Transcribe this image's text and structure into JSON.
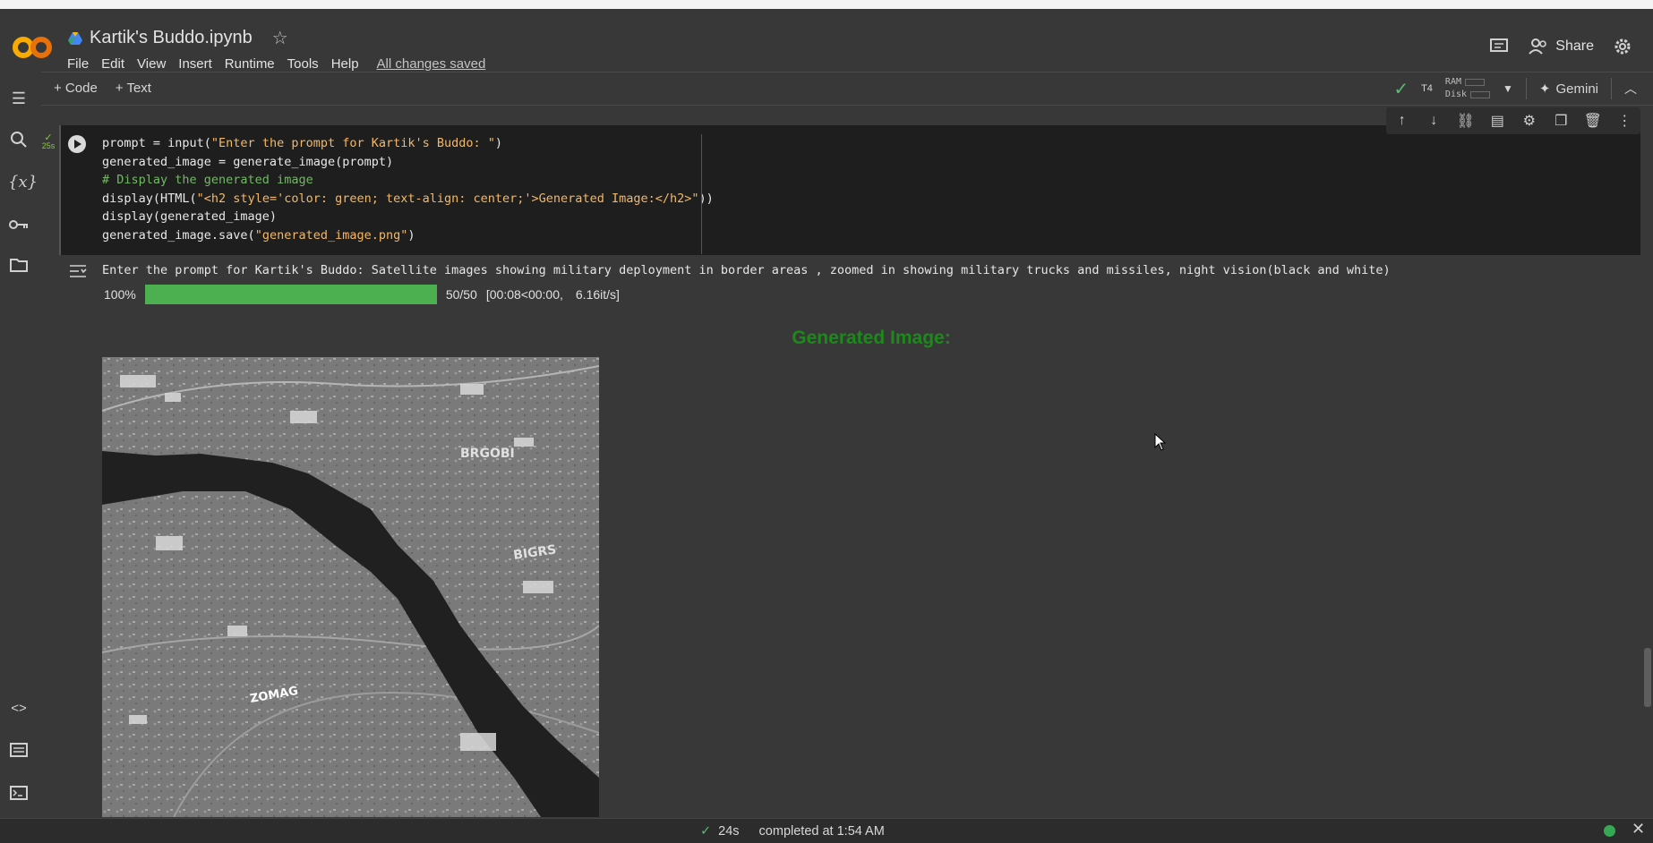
{
  "app": {
    "logo_text": "CO",
    "title": "Kartik's Buddo.ipynb",
    "menu": [
      "File",
      "Edit",
      "View",
      "Insert",
      "Runtime",
      "Tools",
      "Help"
    ],
    "save_status": "All changes saved",
    "share_label": "Share"
  },
  "toolbar": {
    "add_code": "+ Code",
    "add_text": "+ Text",
    "runtime": "T4",
    "ram_label": "RAM",
    "disk_label": "Disk",
    "gemini": "Gemini"
  },
  "cell": {
    "exec_time": "25s",
    "code_lines": [
      "prompt = input(\"Enter the prompt for Kartik's Buddo: \")",
      "generated_image = generate_image(prompt)",
      "# Display the generated image",
      "display(HTML(\"<h2 style='color: green; text-align: center;'>Generated Image:</h2>\"))",
      "display(generated_image)",
      "generated_image.save(\"generated_image.png\")"
    ]
  },
  "output": {
    "prompt_line": "Enter the prompt for Kartik's Buddo: Satellite images showing military deployment in border areas , zoomed in showing military trucks and missiles, night vision(black and white)",
    "progress_percent_label": "100%",
    "progress_fraction": 1.0,
    "progress_count": "50/50",
    "progress_time": "[00:08<00:00,",
    "progress_rate": "6.16it/s]",
    "heading": "Generated Image:",
    "image_labels": [
      "BRGOBI",
      "BIGRS",
      "ZOMAG"
    ]
  },
  "status": {
    "check_time": "24s",
    "completed": "completed at 1:54 AM"
  },
  "colors": {
    "accent_orange": "#f9ab00",
    "heading_green": "#1b8a1b",
    "progress_green": "#4caf50",
    "status_green": "#34a853"
  }
}
